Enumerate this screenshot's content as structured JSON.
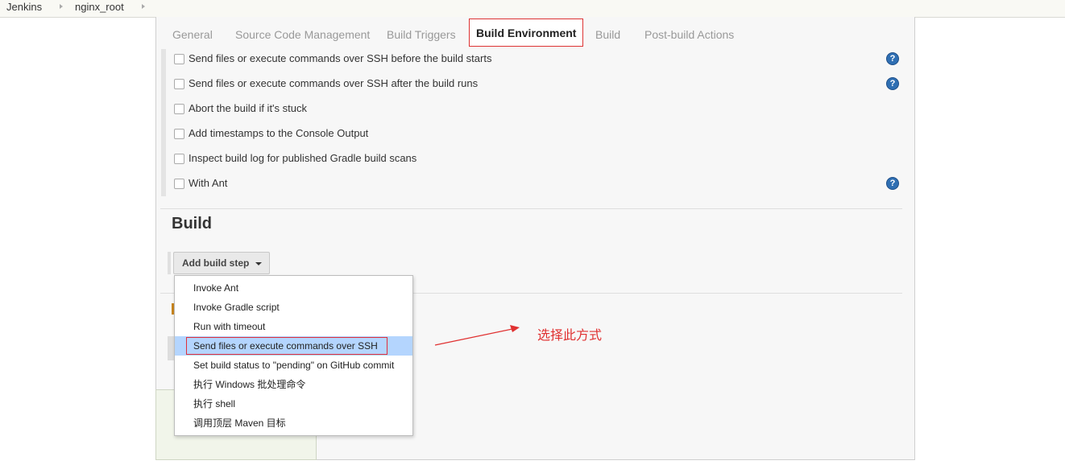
{
  "breadcrumb": {
    "items": [
      "Jenkins",
      "nginx_root"
    ]
  },
  "tabs": [
    {
      "label": "General",
      "active": false
    },
    {
      "label": "Source Code Management",
      "active": false
    },
    {
      "label": "Build Triggers",
      "active": false
    },
    {
      "label": "Build Environment",
      "active": true
    },
    {
      "label": "Build",
      "active": false
    },
    {
      "label": "Post-build Actions",
      "active": false
    }
  ],
  "build_environment": {
    "options": [
      {
        "label": "Send files or execute commands over SSH before the build starts",
        "checked": false,
        "help": true
      },
      {
        "label": "Send files or execute commands over SSH after the build runs",
        "checked": false,
        "help": true
      },
      {
        "label": "Abort the build if it's stuck",
        "checked": false,
        "help": false
      },
      {
        "label": "Add timestamps to the Console Output",
        "checked": false,
        "help": false
      },
      {
        "label": "Inspect build log for published Gradle build scans",
        "checked": false,
        "help": false
      },
      {
        "label": "With Ant",
        "checked": false,
        "help": true
      }
    ]
  },
  "build": {
    "heading": "Build",
    "add_step_label": "Add build step",
    "menu_items": [
      "Invoke Ant",
      "Invoke Gradle script",
      "Run with timeout",
      "Send files or execute commands over SSH",
      "Set build status to \"pending\" on GitHub commit",
      "执行 Windows 批处理命令",
      "执行 shell",
      "调用顶层 Maven 目标"
    ],
    "highlighted_item": "Send files or execute commands over SSH"
  },
  "annotation": {
    "text": "选择此方式",
    "color": "#e03131"
  },
  "icons": {
    "help": "question-mark-icon",
    "breadcrumb_separator": "chevron-right-icon",
    "dropdown_caret": "caret-down-icon"
  },
  "colors": {
    "highlight_border": "#e0303a",
    "menu_hover_bg": "#b4d5fe",
    "help_icon": "#2f6fb3"
  }
}
